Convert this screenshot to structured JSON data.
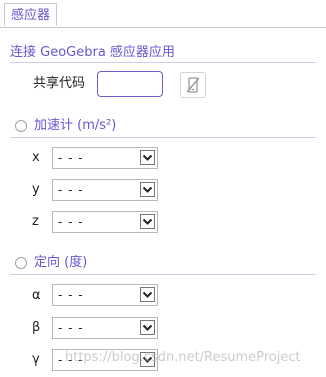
{
  "tab": {
    "label": "感应器"
  },
  "connect": {
    "header": "连接 GeoGebra 感应器应用",
    "share_code_label": "共享代码",
    "share_code_value": "",
    "disconnect_icon": "phone-disconnected-icon"
  },
  "accelerometer": {
    "label": "加速计 (m/s²)",
    "selected": false,
    "axes": [
      {
        "label": "x",
        "value": "- - -"
      },
      {
        "label": "y",
        "value": "- - -"
      },
      {
        "label": "z",
        "value": "- - -"
      }
    ]
  },
  "orientation": {
    "label": "定向 (度)",
    "selected": false,
    "axes": [
      {
        "label": "α",
        "value": "- - -"
      },
      {
        "label": "β",
        "value": "- - -"
      },
      {
        "label": "γ",
        "value": "- - -"
      }
    ]
  },
  "watermark": "https://blog.csdn.net/ResumeProject",
  "colors": {
    "accent": "#6557d2",
    "divider": "#cfcbe8"
  }
}
